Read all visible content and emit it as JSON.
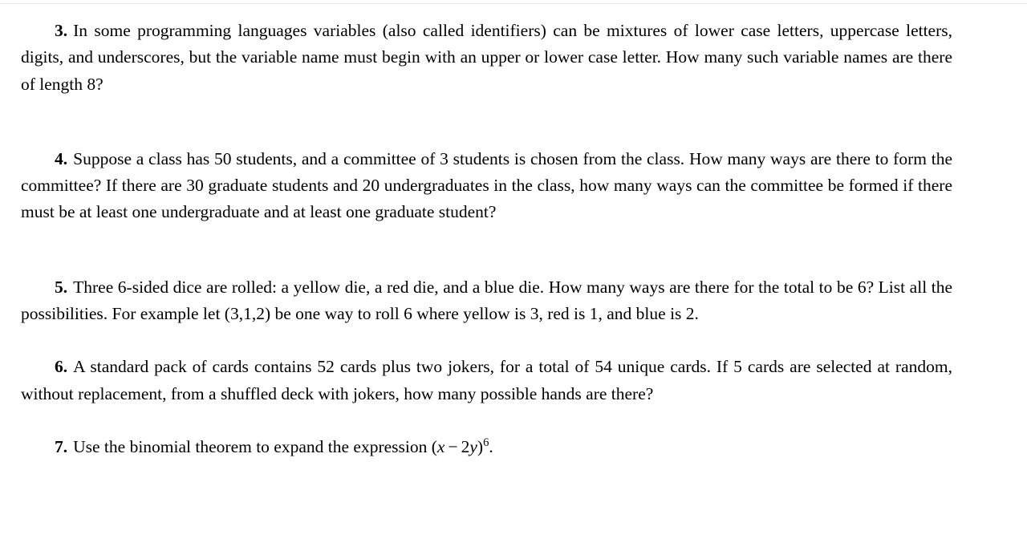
{
  "document": {
    "type": "problem-set",
    "font_style": "serif-latex",
    "text_color": "#000000",
    "background_color": "#ffffff",
    "rule_color": "#e8e8e8"
  },
  "problems": [
    {
      "number": "3.",
      "text": "In some programming languages variables (also called identifiers) can be mixtures of lower case letters, uppercase letters, digits, and underscores, but the variable name must begin with an upper or lower case letter. How many such variable names are there of length 8?"
    },
    {
      "number": "4.",
      "text": "Suppose a class has 50 students, and a committee of 3 students is chosen from the class. How many ways are there to form the committee? If there are 30 graduate students and 20 under­graduates in the class, how many ways can the committee be formed if there must be at least one undergraduate and at least one graduate student?"
    },
    {
      "number": "5.",
      "text": "Three 6-sided dice are rolled: a yellow die, a red die, and a blue die. How many ways are there for the total to be 6? List all the possibilities. For example let (3,1,2) be one way to roll 6 where yellow is 3, red is 1, and blue is 2."
    },
    {
      "number": "6.",
      "text": "A standard pack of cards contains 52 cards plus two jokers, for a total of 54 unique cards. If 5 cards are selected at random, without replacement, from a shuffled deck with jokers, how many possible hands are there?"
    },
    {
      "number": "7.",
      "text_before_math": "Use the binomial theorem to expand the expression ",
      "math": {
        "open_paren": "(",
        "base_var": "x",
        "operator": "−",
        "coefficient": "2",
        "second_var": "y",
        "close_paren": ")",
        "exponent": "6"
      },
      "text_after_math": "."
    }
  ]
}
